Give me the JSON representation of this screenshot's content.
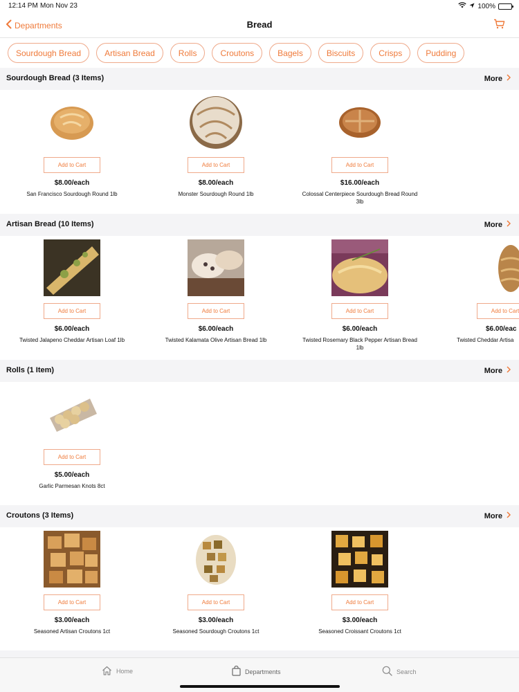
{
  "status": {
    "time": "12:14 PM",
    "date": "Mon Nov 23",
    "battery": "100%"
  },
  "nav": {
    "back_label": "Departments",
    "title": "Bread"
  },
  "chips": [
    "Sourdough Bread",
    "Artisan Bread",
    "Rolls",
    "Croutons",
    "Bagels",
    "Biscuits",
    "Crisps",
    "Pudding"
  ],
  "sections": [
    {
      "title": "Sourdough Bread (3 Items)",
      "more": "More",
      "products": [
        {
          "name": "San Francisco Sourdough Round 1lb",
          "price": "$8.00/each",
          "cta": "Add to Cart",
          "icon": "sourdough-round-photo"
        },
        {
          "name": "Monster Sourdough Round 1lb",
          "price": "$8.00/each",
          "cta": "Add to Cart",
          "icon": "sourdough-round-photo"
        },
        {
          "name": "Colossal Centerpiece Sourdough Bread Round 3lb",
          "price": "$16.00/each",
          "cta": "Add to Cart",
          "icon": "sourdough-round-photo"
        }
      ]
    },
    {
      "title": "Artisan Bread (10 Items)",
      "more": "More",
      "products": [
        {
          "name": "Twisted Jalapeno Cheddar Artisan Loaf 1lb",
          "price": "$6.00/each",
          "cta": "Add to Cart",
          "icon": "artisan-loaf-photo"
        },
        {
          "name": "Twisted Kalamata Olive Artisan Bread 1lb",
          "price": "$6.00/each",
          "cta": "Add to Cart",
          "icon": "artisan-loaf-photo"
        },
        {
          "name": "Twisted Rosemary Black Pepper Artisan Bread 1lb",
          "price": "$6.00/each",
          "cta": "Add to Cart",
          "icon": "artisan-loaf-photo"
        },
        {
          "name": "Twisted Cheddar Artisa",
          "price": "$6.00/eac",
          "cta": "Add to Cart",
          "icon": "artisan-loaf-photo"
        }
      ]
    },
    {
      "title": "Rolls (1 Item)",
      "more": "More",
      "products": [
        {
          "name": "Garlic Parmesan Knots 8ct",
          "price": "$5.00/each",
          "cta": "Add to Cart",
          "icon": "garlic-knots-photo"
        }
      ]
    },
    {
      "title": "Croutons (3 Items)",
      "more": "More",
      "products": [
        {
          "name": "Seasoned Artisan Croutons 1ct",
          "price": "$3.00/each",
          "cta": "Add to Cart",
          "icon": "croutons-photo"
        },
        {
          "name": "Seasoned Sourdough Croutons 1ct",
          "price": "$3.00/each",
          "cta": "Add to Cart",
          "icon": "croutons-photo"
        },
        {
          "name": "Seasoned Croissant Croutons 1ct",
          "price": "$3.00/each",
          "cta": "Add to Cart",
          "icon": "croutons-photo"
        }
      ]
    }
  ],
  "tabs": [
    {
      "label": "Home",
      "icon": "home-icon"
    },
    {
      "label": "Departments",
      "icon": "bag-icon"
    },
    {
      "label": "Search",
      "icon": "search-icon"
    }
  ],
  "colors": {
    "accent": "#ef7a3a",
    "section_bg": "#f4f4f6",
    "chip_border": "#efa98a"
  }
}
